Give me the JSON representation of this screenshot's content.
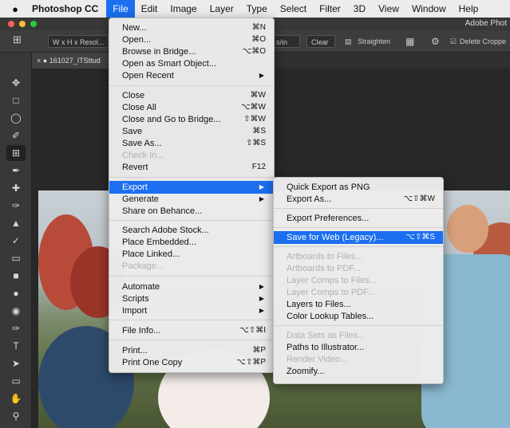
{
  "menubar": {
    "app": "Photoshop CC",
    "items": [
      "File",
      "Edit",
      "Image",
      "Layer",
      "Type",
      "Select",
      "Filter",
      "3D",
      "View",
      "Window",
      "Help"
    ]
  },
  "window": {
    "title": "Adobe Phot"
  },
  "options_bar": {
    "ratio": "W x H x Resol...",
    "zoom_suffix": "s/in",
    "clear": "Clear",
    "straighten": "Straighten",
    "delete_cropped": "Delete Croppe"
  },
  "document": {
    "tab": "161027_ITSttud"
  },
  "file_menu": {
    "items": [
      {
        "label": "New...",
        "shortcut": "⌘N"
      },
      {
        "label": "Open...",
        "shortcut": "⌘O"
      },
      {
        "label": "Browse in Bridge...",
        "shortcut": "⌥⌘O"
      },
      {
        "label": "Open as Smart Object...",
        "shortcut": ""
      },
      {
        "label": "Open Recent",
        "shortcut": ""
      },
      {
        "label": "Close",
        "shortcut": "⌘W"
      },
      {
        "label": "Close All",
        "shortcut": "⌥⌘W"
      },
      {
        "label": "Close and Go to Bridge...",
        "shortcut": "⇧⌘W"
      },
      {
        "label": "Save",
        "shortcut": "⌘S"
      },
      {
        "label": "Save As...",
        "shortcut": "⇧⌘S"
      },
      {
        "label": "Check In...",
        "shortcut": ""
      },
      {
        "label": "Revert",
        "shortcut": "F12"
      },
      {
        "label": "Export",
        "shortcut": ""
      },
      {
        "label": "Generate",
        "shortcut": ""
      },
      {
        "label": "Share on Behance...",
        "shortcut": ""
      },
      {
        "label": "Search Adobe Stock...",
        "shortcut": ""
      },
      {
        "label": "Place Embedded...",
        "shortcut": ""
      },
      {
        "label": "Place Linked...",
        "shortcut": ""
      },
      {
        "label": "Package...",
        "shortcut": ""
      },
      {
        "label": "Automate",
        "shortcut": ""
      },
      {
        "label": "Scripts",
        "shortcut": ""
      },
      {
        "label": "Import",
        "shortcut": ""
      },
      {
        "label": "File Info...",
        "shortcut": "⌥⇧⌘I"
      },
      {
        "label": "Print...",
        "shortcut": "⌘P"
      },
      {
        "label": "Print One Copy",
        "shortcut": "⌥⇧⌘P"
      }
    ]
  },
  "export_menu": {
    "items": [
      {
        "label": "Quick Export as PNG",
        "shortcut": ""
      },
      {
        "label": "Export As...",
        "shortcut": "⌥⇧⌘W"
      },
      {
        "label": "Export Preferences...",
        "shortcut": ""
      },
      {
        "label": "Save for Web (Legacy)...",
        "shortcut": "⌥⇧⌘S"
      },
      {
        "label": "Artboards to Files...",
        "shortcut": ""
      },
      {
        "label": "Artboards to PDF...",
        "shortcut": ""
      },
      {
        "label": "Layer Comps to Files...",
        "shortcut": ""
      },
      {
        "label": "Layer Comps to PDF...",
        "shortcut": ""
      },
      {
        "label": "Layers to Files...",
        "shortcut": ""
      },
      {
        "label": "Color Lookup Tables...",
        "shortcut": ""
      },
      {
        "label": "Data Sets as Files...",
        "shortcut": ""
      },
      {
        "label": "Paths to Illustrator...",
        "shortcut": ""
      },
      {
        "label": "Render Video...",
        "shortcut": ""
      },
      {
        "label": "Zoomify...",
        "shortcut": ""
      }
    ]
  },
  "colors": {
    "highlight": "#1b6ff0",
    "menu_bg": "#ececec",
    "disabled_text": "#b0b0b0"
  }
}
